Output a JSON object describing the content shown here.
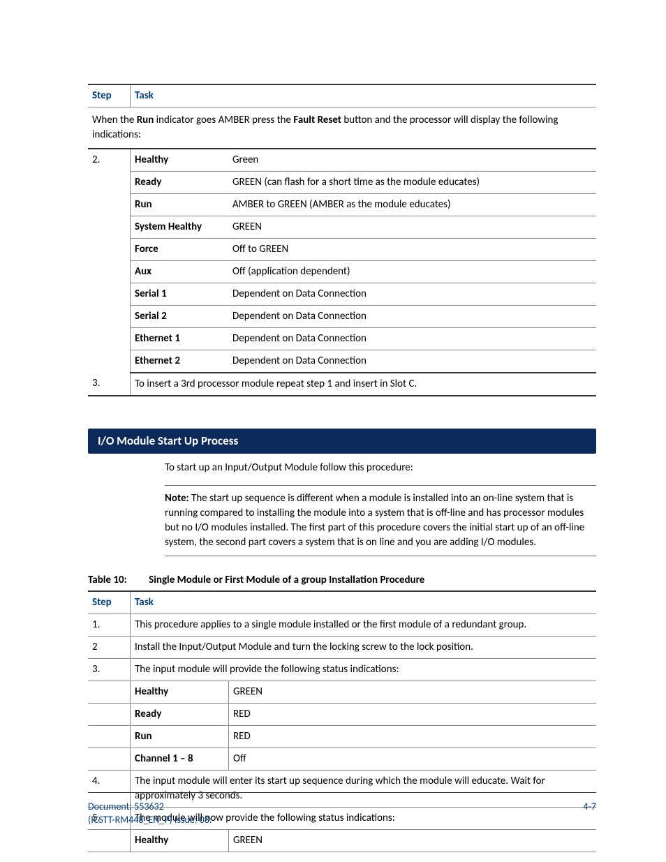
{
  "table1": {
    "headers": {
      "step": "Step",
      "task": "Task"
    },
    "intro": {
      "pre": "When the ",
      "b1": "Run",
      "mid1": " indicator goes AMBER press the ",
      "b2": "Fault Reset",
      "post": " button and the processor will display the following indications:"
    },
    "step2": "2.",
    "indicators": [
      {
        "label": "Healthy",
        "value": "Green"
      },
      {
        "label": "Ready",
        "value": "GREEN (can flash for a short time as the module educates)"
      },
      {
        "label": "Run",
        "value": "AMBER to GREEN (AMBER as the module educates)"
      },
      {
        "label": "System Healthy",
        "value": "GREEN"
      },
      {
        "label": "Force",
        "value": "Off to GREEN"
      },
      {
        "label": "Aux",
        "value": "Off (application dependent)"
      },
      {
        "label": "Serial 1",
        "value": "Dependent on Data Connection"
      },
      {
        "label": "Serial 2",
        "value": "Dependent on Data Connection"
      },
      {
        "label": "Ethernet 1",
        "value": "Dependent on Data Connection"
      },
      {
        "label": "Ethernet 2",
        "value": "Dependent on Data Connection"
      }
    ],
    "step3": {
      "num": "3.",
      "text": "To insert a 3rd processor module repeat step 1 and insert in Slot C."
    }
  },
  "section": {
    "title": "I/O Module Start Up Process",
    "intro": "To start up an Input/Output Module follow this procedure:",
    "note_label": "Note:",
    "note_body": " The start up sequence is different when a module is installed into an on-line system that is running compared to installing the module into a system that is off-line and has processor modules but no I/O modules installed. The first part of this procedure covers the initial start up of an off-line system, the second part covers a system that is on line and you are adding I/O modules."
  },
  "table2": {
    "caption_num": "Table 10:",
    "caption_text": "Single Module or First Module of a group Installation Procedure",
    "headers": {
      "step": "Step",
      "task": "Task"
    },
    "rows": {
      "r1": {
        "num": "1.",
        "text": "This procedure applies to a single module installed or the first module of a redundant group."
      },
      "r2": {
        "num": "2",
        "text": "Install the Input/Output Module and turn the locking screw to the lock position."
      },
      "r3": {
        "num": "3.",
        "text": "The input module will provide the following status indications:"
      },
      "ind1": {
        "label": "Healthy",
        "value": "GREEN"
      },
      "ind2": {
        "label": "Ready",
        "value": "RED"
      },
      "ind3": {
        "label": "Run",
        "value": "RED"
      },
      "ind4": {
        "label": "Channel 1 – 8",
        "value": "Off"
      },
      "r4": {
        "num": "4.",
        "text": "The input module will enter its start up sequence during which the module will educate. Wait for approximately 3 seconds."
      },
      "r5": {
        "num": "5.",
        "text": "The module will now provide the following status indications:"
      },
      "ind5": {
        "label": "Healthy",
        "value": "GREEN"
      }
    }
  },
  "footer": {
    "doc_line1": "Document: 553632",
    "doc_line2": "(ICSTT-RM448_EN_P) Issue: 08:",
    "page": "4-7"
  }
}
